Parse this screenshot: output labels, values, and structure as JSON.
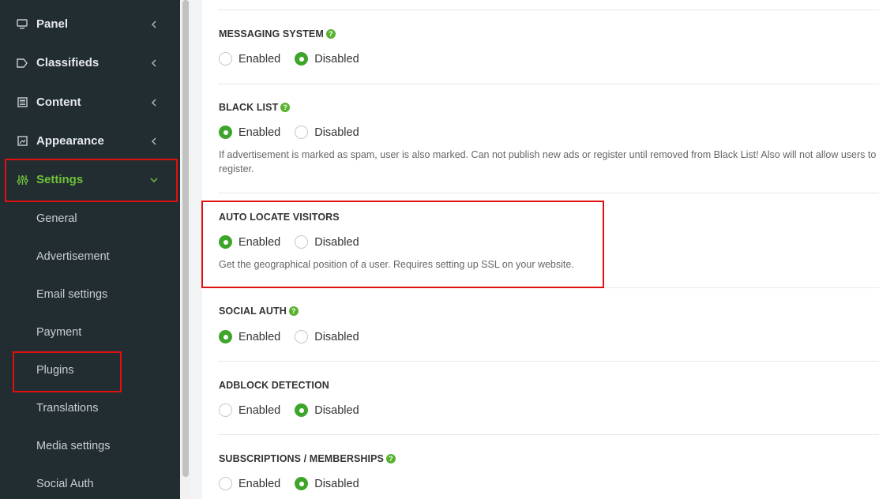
{
  "sidebar": {
    "items": [
      {
        "label": "Panel",
        "icon": "monitor-icon"
      },
      {
        "label": "Classifieds",
        "icon": "tag-icon"
      },
      {
        "label": "Content",
        "icon": "newspaper-icon"
      },
      {
        "label": "Appearance",
        "icon": "palette-icon"
      },
      {
        "label": "Settings",
        "icon": "sliders-icon"
      }
    ],
    "subitems": [
      "General",
      "Advertisement",
      "Email settings",
      "Payment",
      "Plugins",
      "Translations",
      "Media settings",
      "Social Auth"
    ]
  },
  "sections": [
    {
      "title": "MESSAGING SYSTEM",
      "help": "?",
      "enabled_label": "Enabled",
      "disabled_label": "Disabled",
      "selected": "Disabled",
      "description": ""
    },
    {
      "title": "BLACK LIST",
      "help": "?",
      "enabled_label": "Enabled",
      "disabled_label": "Disabled",
      "selected": "Enabled",
      "description": "If advertisement is marked as spam, user is also marked. Can not publish new ads or register until removed from Black List! Also will not allow users to register."
    },
    {
      "title": "AUTO LOCATE VISITORS",
      "enabled_label": "Enabled",
      "disabled_label": "Disabled",
      "selected": "Enabled",
      "description": "Get the geographical position of a user. Requires setting up SSL on your website."
    },
    {
      "title": "SOCIAL AUTH",
      "help": "?",
      "enabled_label": "Enabled",
      "disabled_label": "Disabled",
      "selected": "Enabled",
      "description": ""
    },
    {
      "title": "ADBLOCK DETECTION",
      "enabled_label": "Enabled",
      "disabled_label": "Disabled",
      "selected": "Disabled",
      "description": ""
    },
    {
      "title": "SUBSCRIPTIONS / MEMBERSHIPS",
      "help": "?",
      "enabled_label": "Enabled",
      "disabled_label": "Disabled",
      "selected": "Disabled",
      "description": ""
    }
  ],
  "colors": {
    "accent": "#3ea52b",
    "sidebar_bg": "#222d32",
    "highlight": "#e01010"
  }
}
